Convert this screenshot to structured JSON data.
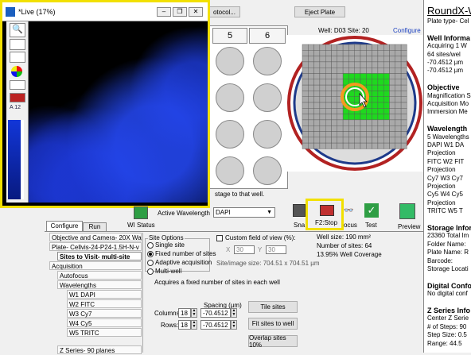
{
  "top_buttons": {
    "protocol": "otocol...",
    "eject": "Eject Plate"
  },
  "live_window": {
    "title": "*Live (17%)"
  },
  "plate": {
    "col5": "5",
    "col6": "6",
    "hint": "stage to that well."
  },
  "well_map": {
    "well_site": "Well: D03   Site: 20",
    "configure": "Configure"
  },
  "toolbar": {
    "wl_status": "WI Status",
    "active_wavelength_label": "Active Wavelength",
    "active_wavelength_value": "DAPI",
    "snap": "Sna",
    "stop": "F2:Stop",
    "focus": "ocus",
    "test": "Test",
    "preview": "Preview"
  },
  "tabs": {
    "configure": "Configure",
    "run": "Run"
  },
  "tree": [
    "Objective and Camera- 20X Wa",
    "Plate- Cellvis-24-P24-1.5H-N-v",
    "Sites to Visit- multi-site",
    "Acquisition",
    "Autofocus",
    "Wavelengths",
    "W1 DAPI",
    "W2 FITC",
    "W3 Cy7",
    "W4 Cy5",
    "W5 TRITC",
    "Z Series- 90 planes"
  ],
  "site_options": {
    "title": "Site Options",
    "single": "Single site",
    "fixed": "Fixed number of sites",
    "adaptive": "Adaptive acquisition",
    "multiwell": "Multi-well",
    "custom_fov": "Custom field of view (%):",
    "fov_x": "30",
    "fov_y": "30",
    "site_image_size": "Site/image size: 704.51 x 704.51 µm",
    "well_size": "Well size: 190 mm²",
    "num_sites": "Number of sites: 64",
    "coverage": "13.95% Well Coverage",
    "description": "Acquires a fixed number of sites in each well",
    "spacing": "Spacing (µm)",
    "columns_label": "Columns:",
    "columns_value": "18",
    "columns_spacing": "-70.4512",
    "rows_label": "Rows:",
    "rows_value": "18",
    "rows_spacing": "-70.4512",
    "tile_btn": "Tile sites",
    "fit_btn": "Fit sites to well",
    "overlap_btn": "Overlap sites 10%"
  },
  "right_panel": [
    {
      "t": "RoundX-W",
      "s": "title"
    },
    {
      "t": "Plate type- Cel",
      "s": "n"
    },
    {
      "t": "",
      "s": "n"
    },
    {
      "t": "Well Informa",
      "s": "h"
    },
    {
      "t": "Acquiring 1 W",
      "s": "n"
    },
    {
      "t": "    64 sites/wel",
      "s": "n"
    },
    {
      "t": "    -70.4512 µm",
      "s": "n"
    },
    {
      "t": "    -70.4512 µm",
      "s": "n"
    },
    {
      "t": "",
      "s": "n"
    },
    {
      "t": "Objective",
      "s": "h"
    },
    {
      "t": "Magnification S",
      "s": "n"
    },
    {
      "t": "Acquisition Mo",
      "s": "n"
    },
    {
      "t": "Immersion Me",
      "s": "n"
    },
    {
      "t": "",
      "s": "n"
    },
    {
      "t": "Wavelength",
      "s": "h"
    },
    {
      "t": "5 Wavelengths",
      "s": "n"
    },
    {
      "t": "DAPI    W1 DA",
      "s": "n"
    },
    {
      "t": "Projection",
      "s": "n"
    },
    {
      "t": "FITC    W2 FIT",
      "s": "n"
    },
    {
      "t": "Projection",
      "s": "n"
    },
    {
      "t": "Cy7    W3 Cy7",
      "s": "n"
    },
    {
      "t": "Projection",
      "s": "n"
    },
    {
      "t": "Cy5    W4 Cy5",
      "s": "n"
    },
    {
      "t": "Projection",
      "s": "n"
    },
    {
      "t": "TRITC    W5 T",
      "s": "n"
    },
    {
      "t": "",
      "s": "n"
    },
    {
      "t": "Storage Infor",
      "s": "h"
    },
    {
      "t": "23360 Total Im",
      "s": "n"
    },
    {
      "t": "Folder Name:",
      "s": "n"
    },
    {
      "t": "Plate Name: R",
      "s": "n"
    },
    {
      "t": "Barcode:",
      "s": "n"
    },
    {
      "t": "Storage Locati",
      "s": "n"
    },
    {
      "t": "",
      "s": "n"
    },
    {
      "t": "Digital Confo",
      "s": "h"
    },
    {
      "t": "No digital conf",
      "s": "n"
    },
    {
      "t": "",
      "s": "n"
    },
    {
      "t": "Z Series Info",
      "s": "h"
    },
    {
      "t": "Center Z Serie",
      "s": "n"
    },
    {
      "t": "# of Steps: 90",
      "s": "n"
    },
    {
      "t": "Step Size: 0.5",
      "s": "n"
    },
    {
      "t": "Range: 44.5",
      "s": "n"
    }
  ]
}
